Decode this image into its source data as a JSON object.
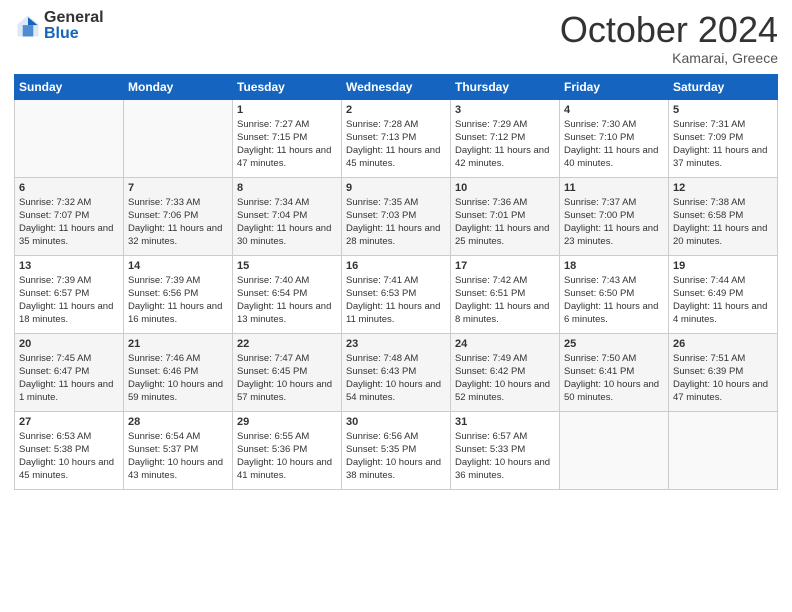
{
  "logo": {
    "general": "General",
    "blue": "Blue"
  },
  "header": {
    "month": "October 2024",
    "location": "Kamarai, Greece"
  },
  "weekdays": [
    "Sunday",
    "Monday",
    "Tuesday",
    "Wednesday",
    "Thursday",
    "Friday",
    "Saturday"
  ],
  "weeks": [
    [
      {
        "day": "",
        "sunrise": "",
        "sunset": "",
        "daylight": ""
      },
      {
        "day": "",
        "sunrise": "",
        "sunset": "",
        "daylight": ""
      },
      {
        "day": "1",
        "sunrise": "Sunrise: 7:27 AM",
        "sunset": "Sunset: 7:15 PM",
        "daylight": "Daylight: 11 hours and 47 minutes."
      },
      {
        "day": "2",
        "sunrise": "Sunrise: 7:28 AM",
        "sunset": "Sunset: 7:13 PM",
        "daylight": "Daylight: 11 hours and 45 minutes."
      },
      {
        "day": "3",
        "sunrise": "Sunrise: 7:29 AM",
        "sunset": "Sunset: 7:12 PM",
        "daylight": "Daylight: 11 hours and 42 minutes."
      },
      {
        "day": "4",
        "sunrise": "Sunrise: 7:30 AM",
        "sunset": "Sunset: 7:10 PM",
        "daylight": "Daylight: 11 hours and 40 minutes."
      },
      {
        "day": "5",
        "sunrise": "Sunrise: 7:31 AM",
        "sunset": "Sunset: 7:09 PM",
        "daylight": "Daylight: 11 hours and 37 minutes."
      }
    ],
    [
      {
        "day": "6",
        "sunrise": "Sunrise: 7:32 AM",
        "sunset": "Sunset: 7:07 PM",
        "daylight": "Daylight: 11 hours and 35 minutes."
      },
      {
        "day": "7",
        "sunrise": "Sunrise: 7:33 AM",
        "sunset": "Sunset: 7:06 PM",
        "daylight": "Daylight: 11 hours and 32 minutes."
      },
      {
        "day": "8",
        "sunrise": "Sunrise: 7:34 AM",
        "sunset": "Sunset: 7:04 PM",
        "daylight": "Daylight: 11 hours and 30 minutes."
      },
      {
        "day": "9",
        "sunrise": "Sunrise: 7:35 AM",
        "sunset": "Sunset: 7:03 PM",
        "daylight": "Daylight: 11 hours and 28 minutes."
      },
      {
        "day": "10",
        "sunrise": "Sunrise: 7:36 AM",
        "sunset": "Sunset: 7:01 PM",
        "daylight": "Daylight: 11 hours and 25 minutes."
      },
      {
        "day": "11",
        "sunrise": "Sunrise: 7:37 AM",
        "sunset": "Sunset: 7:00 PM",
        "daylight": "Daylight: 11 hours and 23 minutes."
      },
      {
        "day": "12",
        "sunrise": "Sunrise: 7:38 AM",
        "sunset": "Sunset: 6:58 PM",
        "daylight": "Daylight: 11 hours and 20 minutes."
      }
    ],
    [
      {
        "day": "13",
        "sunrise": "Sunrise: 7:39 AM",
        "sunset": "Sunset: 6:57 PM",
        "daylight": "Daylight: 11 hours and 18 minutes."
      },
      {
        "day": "14",
        "sunrise": "Sunrise: 7:39 AM",
        "sunset": "Sunset: 6:56 PM",
        "daylight": "Daylight: 11 hours and 16 minutes."
      },
      {
        "day": "15",
        "sunrise": "Sunrise: 7:40 AM",
        "sunset": "Sunset: 6:54 PM",
        "daylight": "Daylight: 11 hours and 13 minutes."
      },
      {
        "day": "16",
        "sunrise": "Sunrise: 7:41 AM",
        "sunset": "Sunset: 6:53 PM",
        "daylight": "Daylight: 11 hours and 11 minutes."
      },
      {
        "day": "17",
        "sunrise": "Sunrise: 7:42 AM",
        "sunset": "Sunset: 6:51 PM",
        "daylight": "Daylight: 11 hours and 8 minutes."
      },
      {
        "day": "18",
        "sunrise": "Sunrise: 7:43 AM",
        "sunset": "Sunset: 6:50 PM",
        "daylight": "Daylight: 11 hours and 6 minutes."
      },
      {
        "day": "19",
        "sunrise": "Sunrise: 7:44 AM",
        "sunset": "Sunset: 6:49 PM",
        "daylight": "Daylight: 11 hours and 4 minutes."
      }
    ],
    [
      {
        "day": "20",
        "sunrise": "Sunrise: 7:45 AM",
        "sunset": "Sunset: 6:47 PM",
        "daylight": "Daylight: 11 hours and 1 minute."
      },
      {
        "day": "21",
        "sunrise": "Sunrise: 7:46 AM",
        "sunset": "Sunset: 6:46 PM",
        "daylight": "Daylight: 10 hours and 59 minutes."
      },
      {
        "day": "22",
        "sunrise": "Sunrise: 7:47 AM",
        "sunset": "Sunset: 6:45 PM",
        "daylight": "Daylight: 10 hours and 57 minutes."
      },
      {
        "day": "23",
        "sunrise": "Sunrise: 7:48 AM",
        "sunset": "Sunset: 6:43 PM",
        "daylight": "Daylight: 10 hours and 54 minutes."
      },
      {
        "day": "24",
        "sunrise": "Sunrise: 7:49 AM",
        "sunset": "Sunset: 6:42 PM",
        "daylight": "Daylight: 10 hours and 52 minutes."
      },
      {
        "day": "25",
        "sunrise": "Sunrise: 7:50 AM",
        "sunset": "Sunset: 6:41 PM",
        "daylight": "Daylight: 10 hours and 50 minutes."
      },
      {
        "day": "26",
        "sunrise": "Sunrise: 7:51 AM",
        "sunset": "Sunset: 6:39 PM",
        "daylight": "Daylight: 10 hours and 47 minutes."
      }
    ],
    [
      {
        "day": "27",
        "sunrise": "Sunrise: 6:53 AM",
        "sunset": "Sunset: 5:38 PM",
        "daylight": "Daylight: 10 hours and 45 minutes."
      },
      {
        "day": "28",
        "sunrise": "Sunrise: 6:54 AM",
        "sunset": "Sunset: 5:37 PM",
        "daylight": "Daylight: 10 hours and 43 minutes."
      },
      {
        "day": "29",
        "sunrise": "Sunrise: 6:55 AM",
        "sunset": "Sunset: 5:36 PM",
        "daylight": "Daylight: 10 hours and 41 minutes."
      },
      {
        "day": "30",
        "sunrise": "Sunrise: 6:56 AM",
        "sunset": "Sunset: 5:35 PM",
        "daylight": "Daylight: 10 hours and 38 minutes."
      },
      {
        "day": "31",
        "sunrise": "Sunrise: 6:57 AM",
        "sunset": "Sunset: 5:33 PM",
        "daylight": "Daylight: 10 hours and 36 minutes."
      },
      {
        "day": "",
        "sunrise": "",
        "sunset": "",
        "daylight": ""
      },
      {
        "day": "",
        "sunrise": "",
        "sunset": "",
        "daylight": ""
      }
    ]
  ]
}
